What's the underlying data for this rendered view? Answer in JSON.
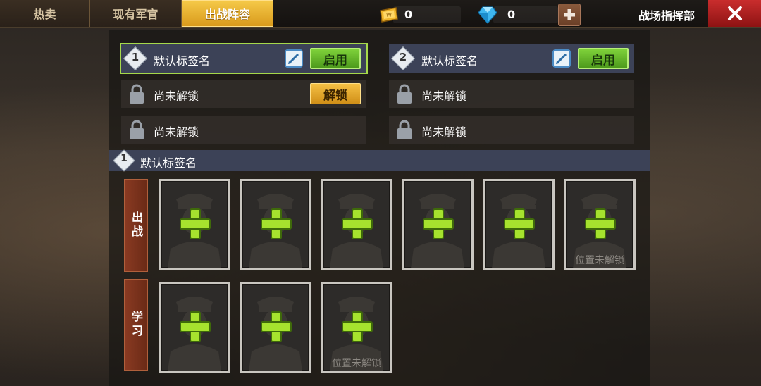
{
  "tabs": [
    {
      "label": "热卖",
      "active": false
    },
    {
      "label": "现有军官",
      "active": false
    },
    {
      "label": "出战阵容",
      "active": true
    }
  ],
  "currency": {
    "gold": {
      "icon": "gold-bar-icon",
      "value": "0"
    },
    "diamond": {
      "icon": "diamond-icon",
      "value": "0"
    }
  },
  "header": {
    "title": "战场指挥部"
  },
  "lineups": [
    {
      "number": "1",
      "name": "默认标签名",
      "button": "启用",
      "state": "active-selected"
    },
    {
      "number": "2",
      "name": "默认标签名",
      "button": "启用",
      "state": "active"
    },
    {
      "label": "尚未解锁",
      "button": "解锁",
      "state": "locked-unlockable"
    },
    {
      "label": "尚未解锁",
      "state": "locked"
    },
    {
      "label": "尚未解锁",
      "state": "locked"
    },
    {
      "label": "尚未解锁",
      "state": "locked"
    }
  ],
  "current_lineup": {
    "number": "1",
    "name": "默认标签名"
  },
  "battle": {
    "label": "出战",
    "slots": [
      {
        "state": "empty"
      },
      {
        "state": "empty"
      },
      {
        "state": "empty"
      },
      {
        "state": "empty"
      },
      {
        "state": "empty"
      },
      {
        "state": "locked",
        "text": "位置未解锁"
      }
    ]
  },
  "study": {
    "label": "学习",
    "slots": [
      {
        "state": "empty"
      },
      {
        "state": "empty"
      },
      {
        "state": "locked",
        "text": "位置未解锁"
      }
    ]
  },
  "colors": {
    "accent_gold": "#f5c948",
    "enable_green": "#7fd13a",
    "close_red": "#c92d2d",
    "add_green": "#a6e22e"
  }
}
